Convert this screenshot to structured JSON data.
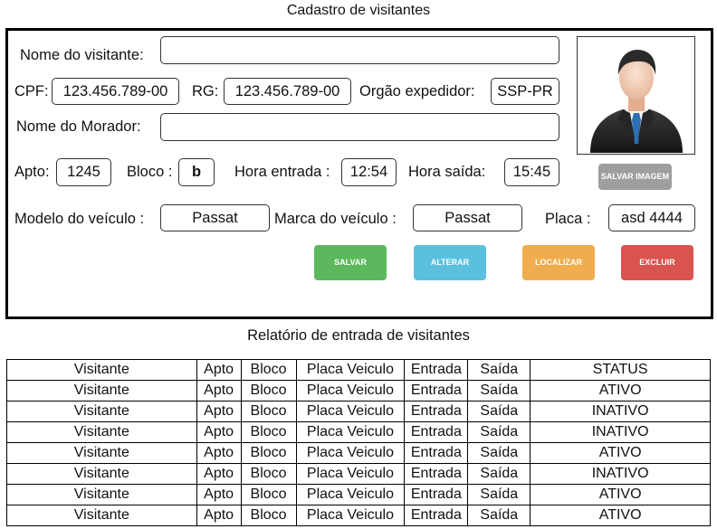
{
  "form": {
    "title": "Cadastro de visitantes",
    "labels": {
      "nome_visitante": "Nome do visitante:",
      "cpf": "CPF:",
      "rg": "RG:",
      "orgao": "Orgão expedidor:",
      "nome_morador": "Nome do Morador:",
      "apto": "Apto:",
      "bloco": "Bloco :",
      "hora_entrada": "Hora entrada :",
      "hora_saida": "Hora saída:",
      "modelo": "Modelo do veículo :",
      "marca": "Marca do veículo :",
      "placa": "Placa :"
    },
    "values": {
      "nome_visitante": "",
      "cpf": "123.456.789-00",
      "rg": "123.456.789-00",
      "orgao": "SSP-PR",
      "nome_morador": "",
      "apto": "1245",
      "bloco": "b",
      "hora_entrada": "12:54",
      "hora_saida": "15:45",
      "modelo": "Passat",
      "marca": "Passat",
      "placa": "asd 4444"
    },
    "buttons": {
      "salvar_imagem": "SALVAR IMAGEM",
      "salvar": "SALVAR",
      "alterar": "ALTERAR",
      "localizar": "LOCALIZAR",
      "excluir": "EXCLUIR"
    },
    "colors": {
      "salvar": "#5cb85c",
      "alterar": "#5bc0de",
      "localizar": "#f0ad4e",
      "excluir": "#d9534f",
      "salvar_imagem": "#9e9e9e"
    },
    "photo_icon": "person-avatar-icon"
  },
  "report": {
    "title": "Relatório de entrada de visitantes",
    "headers": [
      "Visitante",
      "Apto",
      "Bloco",
      "Placa Veiculo",
      "Entrada",
      "Saída",
      "STATUS"
    ],
    "rows": [
      [
        "Visitante",
        "Apto",
        "Bloco",
        "Placa Veiculo",
        "Entrada",
        "Saída",
        "ATIVO"
      ],
      [
        "Visitante",
        "Apto",
        "Bloco",
        "Placa Veiculo",
        "Entrada",
        "Saída",
        "INATIVO"
      ],
      [
        "Visitante",
        "Apto",
        "Bloco",
        "Placa Veiculo",
        "Entrada",
        "Saída",
        "INATIVO"
      ],
      [
        "Visitante",
        "Apto",
        "Bloco",
        "Placa Veiculo",
        "Entrada",
        "Saída",
        "ATIVO"
      ],
      [
        "Visitante",
        "Apto",
        "Bloco",
        "Placa Veiculo",
        "Entrada",
        "Saída",
        "INATIVO"
      ],
      [
        "Visitante",
        "Apto",
        "Bloco",
        "Placa Veiculo",
        "Entrada",
        "Saída",
        "ATIVO"
      ],
      [
        "Visitante",
        "Apto",
        "Bloco",
        "Placa Veiculo",
        "Entrada",
        "Saída",
        "ATIVO"
      ]
    ]
  }
}
